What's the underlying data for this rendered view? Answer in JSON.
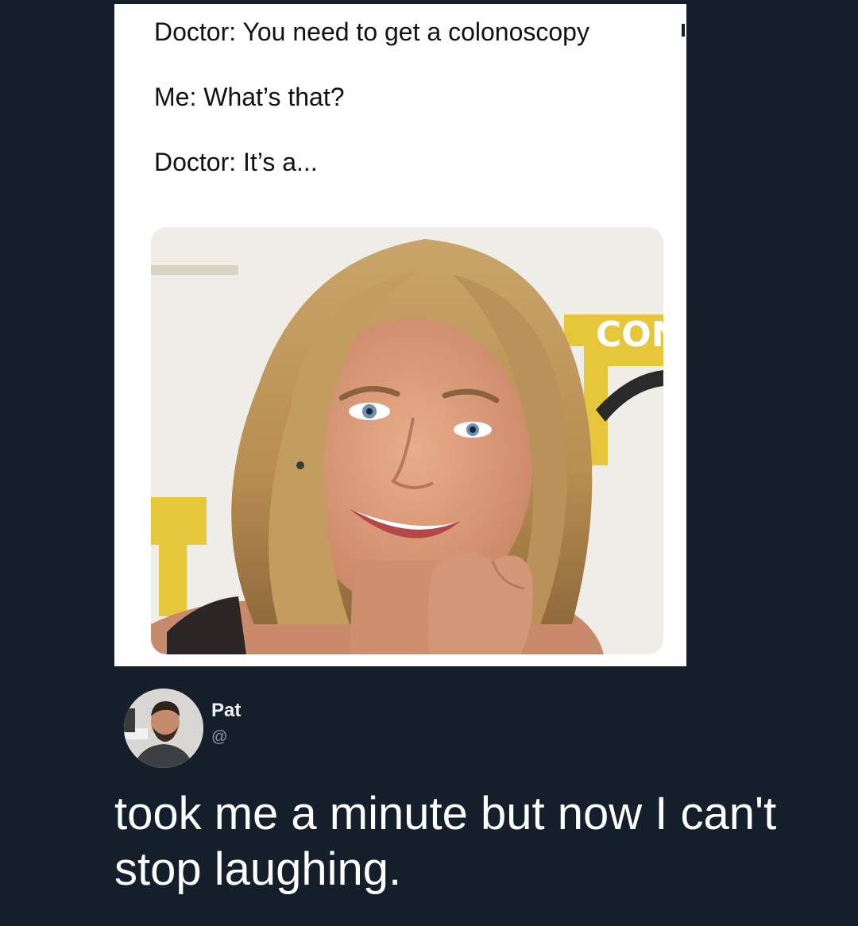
{
  "quoted_card": {
    "lines": [
      "Doctor: You need to get a colonoscopy",
      "Me: What’s that?",
      "Doctor: It’s a..."
    ],
    "photo_icon": "smiling-woman-photo"
  },
  "tweet": {
    "author_name": "Pat",
    "author_handle": "@",
    "avatar_icon": "avatar-photo",
    "text": "took me a minute but now I can't stop laughing."
  },
  "colors": {
    "background": "#151f2c",
    "card": "#ffffff",
    "text_light": "#ffffff",
    "handle": "#8a96a6"
  }
}
